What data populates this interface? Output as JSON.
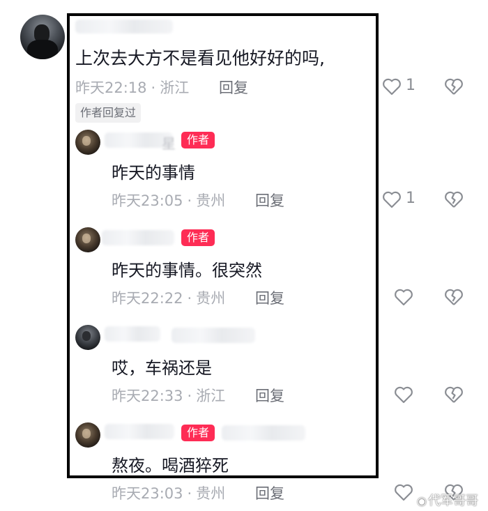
{
  "comment": {
    "text": "上次去大方不是看见他好好的吗,",
    "time": "昨天22:18",
    "location": "浙江",
    "reply_label": "回复",
    "like_count": "1",
    "author_replied": "作者回复过"
  },
  "replies": [
    {
      "author_badge": "作者",
      "name_fragment": "星",
      "text": "昨天的事情",
      "time": "昨天23:05",
      "location": "贵州",
      "reply_label": "回复",
      "like_count": "1"
    },
    {
      "author_badge": "作者",
      "name_fragment": "",
      "text": "昨天的事情。很突然",
      "time": "昨天22:22",
      "location": "贵州",
      "reply_label": "回复",
      "like_count": ""
    },
    {
      "author_badge": "",
      "name_fragment": "",
      "text": "哎，车祸还是",
      "time": "昨天22:33",
      "location": "浙江",
      "reply_label": "回复",
      "like_count": ""
    },
    {
      "author_badge": "作者",
      "name_fragment": "",
      "text": "熬夜。喝酒猝死",
      "time": "昨天23:03",
      "location": "贵州",
      "reply_label": "回复",
      "like_count": ""
    }
  ],
  "watermark": {
    "text": "代军哥哥"
  },
  "colors": {
    "author_badge": "#fe2c55",
    "meta_text": "#a8abb2",
    "icon": "#8a8d93",
    "frame": "#000000"
  },
  "icons": {
    "like": "heart-outline-icon",
    "dislike": "broken-heart-icon",
    "weibo": "weibo-logo"
  }
}
